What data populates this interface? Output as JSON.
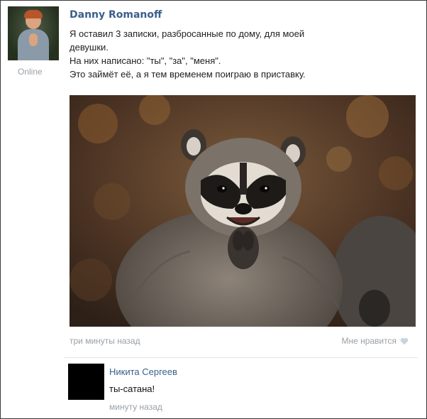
{
  "post": {
    "author": "Danny Romanoff",
    "status": "Online",
    "text_lines": [
      "Я оставил 3 записки, разбросанные по дому, для моей",
      "девушки.",
      "На них написано: \"ты\", \"за\", \"меня\".",
      "Это займёт её, а я тем временем поиграю в приставку."
    ],
    "time": "три минуты назад",
    "like_label": "Мне нравится",
    "like_icon": "heart-icon",
    "photo_subject": "raccoon"
  },
  "comment": {
    "author": "Никита Сергеев",
    "text": "ты-сатана!",
    "time": "минуту назад"
  },
  "colors": {
    "link": "#3a5f8a",
    "muted": "#9aa0a6",
    "border": "#3a3a3a"
  }
}
